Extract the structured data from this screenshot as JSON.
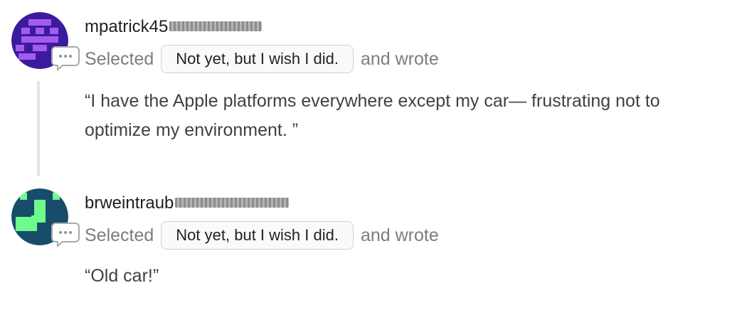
{
  "responses": [
    {
      "username": "mpatrick45",
      "selected_prefix": "Selected",
      "choice": "Not yet, but I wish I did.",
      "wrote_suffix": "and wrote",
      "quote": "“I have the Apple platforms everywhere except my car— frustrating not to optimize my environment. ”",
      "avatar_colors": {
        "bg": "#3b1b9c",
        "pattern": "#a25bf0"
      }
    },
    {
      "username": "brweintraub",
      "selected_prefix": "Selected",
      "choice": "Not yet, but I wish I did.",
      "wrote_suffix": "and wrote",
      "quote": "“Old car!”",
      "avatar_colors": {
        "bg": "#174d6b",
        "pattern": "#6dfc8b"
      }
    }
  ],
  "icons": {
    "comment": "comment-bubble-icon"
  }
}
